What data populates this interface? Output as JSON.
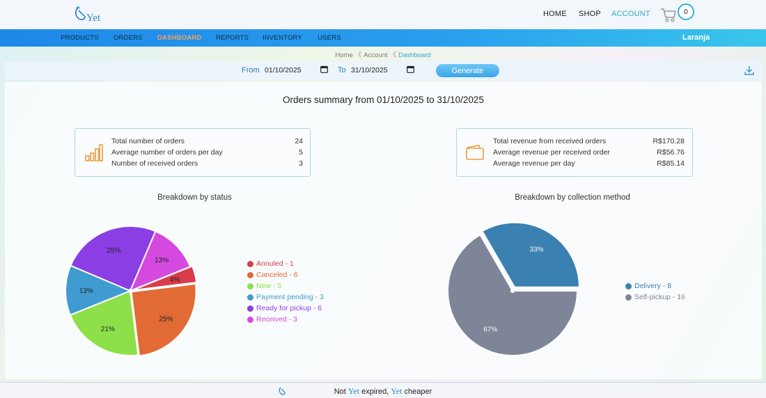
{
  "brand": {
    "name": "Yet"
  },
  "topnav": [
    {
      "label": "HOME",
      "active": false
    },
    {
      "label": "SHOP",
      "active": false
    },
    {
      "label": "ACCOUNT",
      "active": true
    }
  ],
  "cart": {
    "count": "0"
  },
  "mainnav": {
    "items": [
      {
        "label": "PRODUCTS",
        "active": false
      },
      {
        "label": "ORDERS",
        "active": false
      },
      {
        "label": "DASHBOARD",
        "active": true
      },
      {
        "label": "REPORTS",
        "active": false
      },
      {
        "label": "INVENTORY",
        "active": false
      },
      {
        "label": "USERS",
        "active": false
      }
    ],
    "user": "Laranja"
  },
  "breadcrumb": {
    "items": [
      "Home",
      "Account",
      "Dashboard"
    ],
    "separator": "《"
  },
  "filter": {
    "from_label": "From",
    "from_value": "01/10/2025",
    "to_label": "To",
    "to_value": "31/10/2025",
    "generate_label": "Generate"
  },
  "summary": {
    "title": "Orders summary from 01/10/2025 to 31/10/2025"
  },
  "orders_stats": [
    {
      "label": "Total number of orders",
      "value": "24"
    },
    {
      "label": "Average number of orders per day",
      "value": "5"
    },
    {
      "label": "Number of received orders",
      "value": "3"
    }
  ],
  "revenue_stats": [
    {
      "label": "Total revenue from received orders",
      "value": "R$170.28"
    },
    {
      "label": "Average revenue per received order",
      "value": "R$56.76"
    },
    {
      "label": "Average revenue per day",
      "value": "R$85.14"
    }
  ],
  "colors": {
    "annuled": "#d93c4a",
    "canceled": "#e26a35",
    "new": "#8ee04b",
    "payment_pending": "#3f9bd0",
    "ready_for_pickup": "#8a3ee3",
    "received": "#d44ae0",
    "delivery": "#3a80b0",
    "self_pickup": "#7e8599",
    "accent": "#29a9cf",
    "stat_icon": "#ef9a3c"
  },
  "chart_data": [
    {
      "type": "pie",
      "title": "Breakdown by status",
      "slices": [
        {
          "label": "Annuled - 1",
          "value": 1,
          "pct_label": "4%",
          "color_key": "annuled"
        },
        {
          "label": "Canceled - 6",
          "value": 6,
          "pct_label": "25%",
          "color_key": "canceled"
        },
        {
          "label": "New - 5",
          "value": 5,
          "pct_label": "21%",
          "color_key": "new"
        },
        {
          "label": "Payment pending - 3",
          "value": 3,
          "pct_label": "13%",
          "color_key": "payment_pending"
        },
        {
          "label": "Ready for pickup - 6",
          "value": 6,
          "pct_label": "25%",
          "color_key": "ready_for_pickup"
        },
        {
          "label": "Received - 3",
          "value": 3,
          "pct_label": "13%",
          "color_key": "received"
        }
      ],
      "legend_position": "right"
    },
    {
      "type": "pie",
      "title": "Breakdown by collection method",
      "slices": [
        {
          "label": "Delivery - 8",
          "value": 8,
          "pct_label": "33%",
          "color_key": "delivery"
        },
        {
          "label": "Self-pickup - 16",
          "value": 16,
          "pct_label": "67%",
          "color_key": "self_pickup"
        }
      ],
      "legend_position": "right"
    }
  ],
  "footer": {
    "parts": [
      "Not",
      "Yet",
      "expired,",
      "Yet",
      "cheaper"
    ]
  }
}
